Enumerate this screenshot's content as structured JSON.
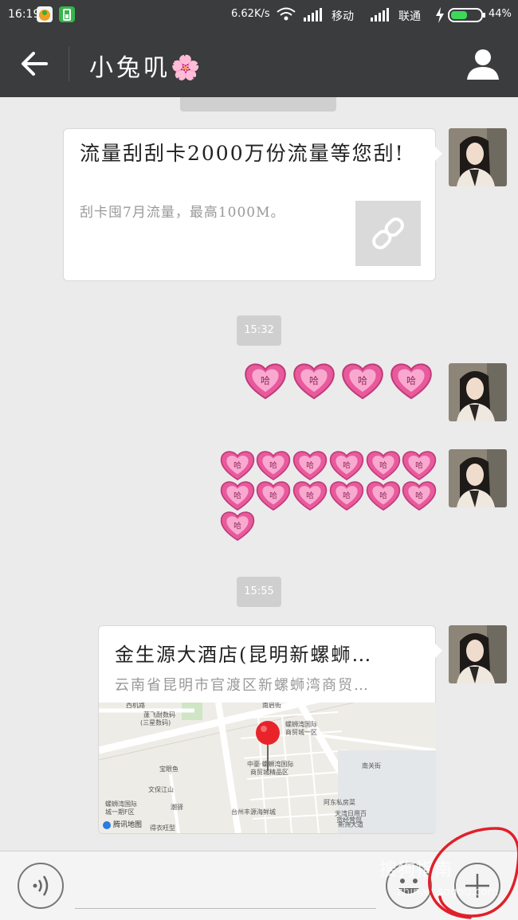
{
  "status_bar": {
    "time": "16:19",
    "net_speed": "6.62K/s",
    "carrier1": "移动",
    "carrier2": "联通",
    "battery": "44%"
  },
  "header": {
    "title": "小兔叽",
    "title_emoji": "🌸"
  },
  "messages": {
    "timestamp_partial": "",
    "link_card": {
      "title": "流量刮刮卡2000万份流量等您刮!",
      "description": "刮卡囤7月流量，最高1000M。",
      "icon": "link-icon"
    },
    "time1": "15:32",
    "sticker_label": "哈",
    "time2": "15:55",
    "location_card": {
      "title": "金生源大酒店(昆明新螺蛳…",
      "address": "云南省昆明市官渡区新螺蛳湾商贸…",
      "map_logo": "腾讯地图",
      "map_labels": [
        "西机路",
        "南启街",
        "蓬飞耐数码",
        "(三星数码)",
        "螺蛳湾国际",
        "商贸城一区",
        "中豪·螺蛳湾国际",
        "商贸城精品区",
        "宝眼鱼",
        "文保江山",
        "阿东私房菜",
        "潮驿",
        "台州丰源海鲜城",
        "天湾日用百",
        "货经营部",
        "螺蛳湾国际",
        "城一期F区",
        "得衣旺型",
        "南关街",
        "新洲大道"
      ]
    }
  },
  "input_bar": {
    "placeholder": "",
    "icons": [
      "voice-icon",
      "emoji-icon",
      "plus-icon"
    ]
  },
  "watermark": {
    "text": "搜狗指南",
    "url": "zhinan.sogou.com"
  },
  "colors": {
    "header_bg": "#3a3c3d",
    "chat_bg": "#ebebeb",
    "bubble_bg": "#ffffff",
    "time_pill": "#cfcfcf",
    "annotation": "#e0202a",
    "heart_pink": "#e85a9c"
  }
}
